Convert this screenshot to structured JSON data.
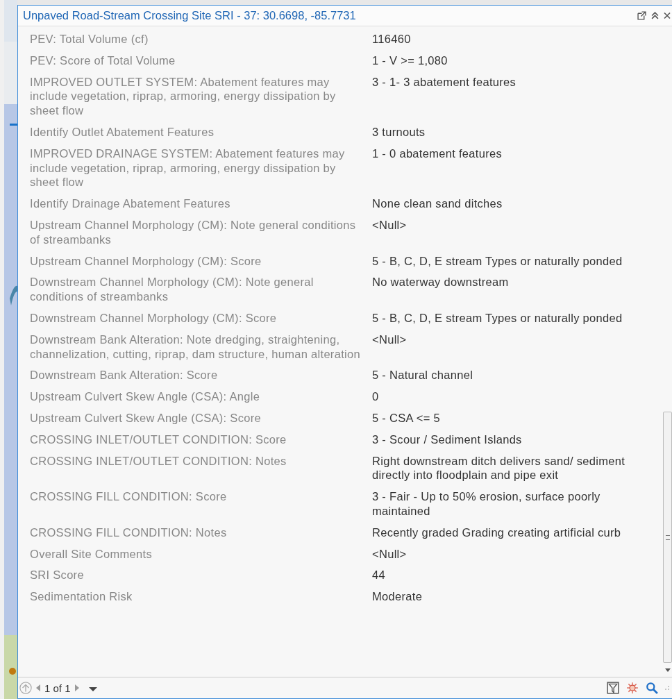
{
  "window": {
    "title": "Unpaved Road-Stream Crossing Site SRI - 37: 30.6698, -85.7731"
  },
  "fields": [
    {
      "label": "PEV: Total Volume (cf)",
      "value": "116460"
    },
    {
      "label": "PEV: Score of Total Volume",
      "value": "1 - V >= 1,080"
    },
    {
      "label": "IMPROVED OUTLET SYSTEM: Abatement features may include vegetation, riprap, armoring, energy dissipation by sheet flow",
      "value": "3 - 1- 3 abatement features"
    },
    {
      "label": "Identify Outlet Abatement Features",
      "value": "3 turnouts"
    },
    {
      "label": "IMPROVED DRAINAGE SYSTEM: Abatement features may include vegetation, riprap, armoring, energy dissipation by sheet flow",
      "value": "1 - 0 abatement features"
    },
    {
      "label": "Identify Drainage Abatement Features",
      "value": "None clean sand ditches"
    },
    {
      "label": "Upstream Channel Morphology (CM): Note general conditions of streambanks",
      "value": "<Null>"
    },
    {
      "label": "Upstream Channel Morphology (CM): Score",
      "value": "5 - B, C, D, E stream Types or naturally ponded"
    },
    {
      "label": "Downstream Channel Morphology (CM): Note general conditions of streambanks",
      "value": "No waterway downstream"
    },
    {
      "label": "Downstream Channel Morphology (CM): Score",
      "value": "5 - B, C, D, E stream Types or naturally ponded"
    },
    {
      "label": "Downstream Bank Alteration: Note dredging, straightening, channelization, cutting, riprap, dam structure, human alteration",
      "value": "<Null>"
    },
    {
      "label": "Downstream Bank Alteration: Score",
      "value": "5 - Natural channel"
    },
    {
      "label": "Upstream Culvert Skew Angle (CSA): Angle",
      "value": "0"
    },
    {
      "label": "Upstream Culvert Skew Angle (CSA): Score",
      "value": "5 - CSA <= 5"
    },
    {
      "label": "CROSSING INLET/OUTLET CONDITION: Score",
      "value": "3 - Scour / Sediment Islands"
    },
    {
      "label": "CROSSING INLET/OUTLET CONDITION: Notes",
      "value": "Right downstream ditch delivers sand/ sediment directly into floodplain and pipe exit"
    },
    {
      "label": "CROSSING FILL CONDITION: Score",
      "value": "3 - Fair - Up to 50% erosion, surface poorly maintained"
    },
    {
      "label": "CROSSING FILL CONDITION: Notes",
      "value": "Recently graded Grading creating artificial curb"
    },
    {
      "label": "Overall Site Comments",
      "value": "<Null>"
    },
    {
      "label": "SRI Score",
      "value": "44"
    },
    {
      "label": "Sedimentation Risk",
      "value": "Moderate"
    }
  ],
  "pager": {
    "text": "1 of 1"
  }
}
